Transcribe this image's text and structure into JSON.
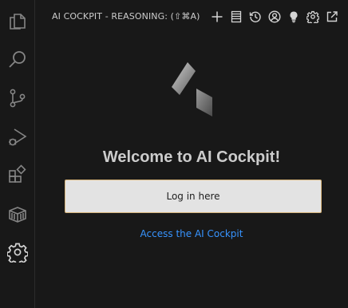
{
  "activity_bar": {
    "items": [
      {
        "name": "explorer",
        "icon": "files-icon"
      },
      {
        "name": "search",
        "icon": "search-icon"
      },
      {
        "name": "source-control",
        "icon": "source-control-icon"
      },
      {
        "name": "run-and-debug",
        "icon": "run-debug-icon"
      },
      {
        "name": "extensions",
        "icon": "extensions-icon"
      },
      {
        "name": "remote-explorer",
        "icon": "box-icon"
      },
      {
        "name": "ai-cockpit",
        "icon": "gear-icon",
        "active": true
      }
    ]
  },
  "panel": {
    "title": "AI COCKPIT - REASONING: (⇧⌘A)",
    "toolbar": [
      "plus-icon",
      "list-icon",
      "history-icon",
      "account-icon",
      "lightbulb-icon",
      "settings-icon",
      "open-external-icon"
    ]
  },
  "welcome": {
    "heading": "Welcome to AI Cockpit!",
    "login_label": "Log in here",
    "access_link": "Access the AI Cockpit"
  },
  "colors": {
    "background": "#181818",
    "foreground": "#cccccc",
    "link": "#3794ff",
    "button_bg": "#e3e3e3",
    "button_border": "#d7b47a"
  }
}
